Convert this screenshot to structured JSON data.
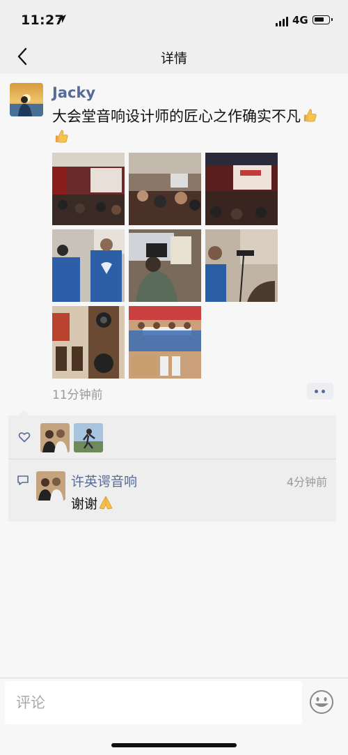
{
  "status_bar": {
    "time": "11:27",
    "network": "4G",
    "icons": [
      "location-arrow-icon",
      "signal-icon",
      "battery-icon"
    ]
  },
  "nav": {
    "title": "详情",
    "back_icon": "chevron-left-icon"
  },
  "post": {
    "author": "Jacky",
    "text": "大会堂音响设计师的匠心之作确实不凡",
    "emoji": [
      "thumbs-up",
      "thumbs-up"
    ],
    "photo_count": 8,
    "time": "11分钟前",
    "more_icon": "more-dots-icon"
  },
  "likes": {
    "icon": "heart-icon",
    "avatars": 2
  },
  "comments": [
    {
      "name": "许英谔音响",
      "time": "4分钟前",
      "text": "谢谢",
      "emoji": "folded-hands"
    }
  ],
  "input": {
    "placeholder": "评论",
    "emoji_icon": "smiley-icon"
  },
  "colors": {
    "link": "#576b95",
    "muted": "#999999",
    "background": "#f7f7f7",
    "comment_bg": "#eeeeee"
  }
}
